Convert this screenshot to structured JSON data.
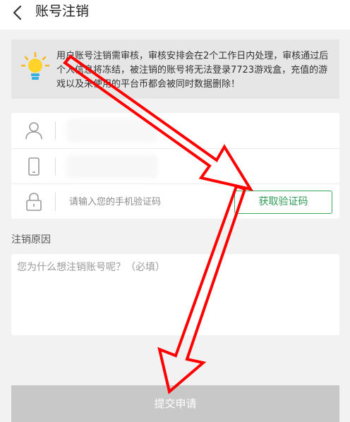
{
  "header": {
    "title": "账号注销",
    "back_icon": "chevron-left-icon"
  },
  "notice": {
    "icon": "lightbulb-icon",
    "text": "用户账号注销需审核，审核安排会在2个工作日内处理，审核通过后个人信息将冻结，被注销的账号将无法登录7723游戏盒，充值的游戏以及未使用的平台币都会被同时数据删除！"
  },
  "form": {
    "account_icon": "user-icon",
    "phone_icon": "phone-icon",
    "lock_icon": "lock-icon",
    "code_placeholder": "请输入您的手机验证码",
    "get_code_label": "获取验证码"
  },
  "reason": {
    "label": "注销原因",
    "placeholder": "您为什么想注销账号呢？（必填）"
  },
  "submit_label": "提交申请",
  "colors": {
    "accent_green": "#2d9b55",
    "annotation_red": "#ff0000",
    "submit_disabled": "#c8c8c8"
  }
}
